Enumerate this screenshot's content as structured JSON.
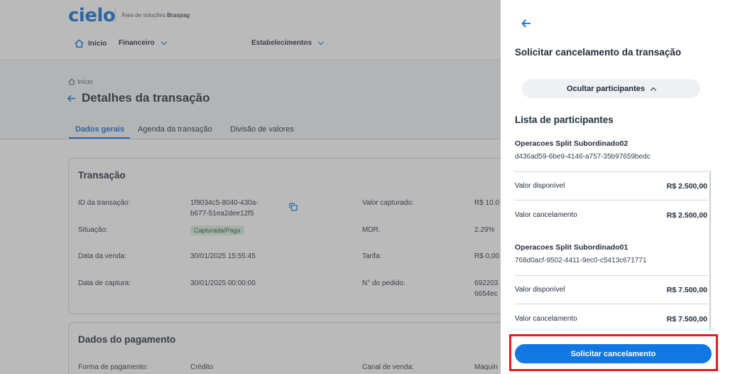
{
  "header": {
    "logo": "cielo",
    "subtitle_prefix": "Área de soluções",
    "subtitle_brand": "Braspag",
    "nav": [
      {
        "label": "Início",
        "icon": "home-icon"
      },
      {
        "label": "Financeiro",
        "icon": "chevron-down-icon"
      },
      {
        "label": "Estabelecimentos",
        "icon": "chevron-down-icon"
      }
    ]
  },
  "page": {
    "breadcrumb": "Início",
    "title": "Detalhes da transação",
    "tabs": [
      {
        "label": "Dados gerais",
        "active": true
      },
      {
        "label": "Agenda da transação",
        "active": false
      },
      {
        "label": "Divisão de valores",
        "active": false
      }
    ]
  },
  "transacao": {
    "title": "Transação",
    "id_label": "ID da transação:",
    "id_value_1": "1f9034c5-8040-430a-",
    "id_value_2": "b677-51ea2dee12f5",
    "situacao_label": "Situação:",
    "situacao_value": "Capturada/Paga",
    "data_venda_label": "Data da venda:",
    "data_venda_value": "30/01/2025 15:55:45",
    "data_captura_label": "Data de captura:",
    "data_captura_value": "30/01/2025 00:00:00",
    "valor_capturado_label": "Valor capturado:",
    "valor_capturado_value": "R$ 10.0",
    "mdr_label": "MDR:",
    "mdr_value": "2.29%",
    "tarifa_label": "Tarifa:",
    "tarifa_value": "R$ 0,00",
    "pedido_label": "N° do pedido:",
    "pedido_value_1": "692203",
    "pedido_value_2": "6654ec"
  },
  "pagamento": {
    "title": "Dados do pagamento",
    "forma_label": "Forma de pagamento:",
    "forma_value": "Crédito",
    "canal_label": "Canal de venda:",
    "canal_value": "Maquin"
  },
  "panel": {
    "title": "Solicitar cancelamento da transação",
    "toggle_label": "Ocultar participantes",
    "list_title": "Lista de participantes",
    "participants": [
      {
        "name": "Operacoes Split Subordinado02",
        "id": "d436ad59-6be9-4146-a757-35b97659bedc",
        "disponivel_label": "Valor disponível",
        "disponivel_value": "R$ 2.500,00",
        "cancelamento_label": "Valor cancelamento",
        "cancelamento_value": "R$ 2.500,00"
      },
      {
        "name": "Operacoes Split Subordinado01",
        "id": "768d0acf-9502-4411-9ec0-c5413c671771",
        "disponivel_label": "Valor disponível",
        "disponivel_value": "R$ 7.500,00",
        "cancelamento_label": "Valor cancelamento",
        "cancelamento_value": "R$ 7.500,00"
      }
    ],
    "submit_label": "Solicitar cancelamento"
  },
  "colors": {
    "accent": "#1177e3",
    "brand": "#0f6fd6",
    "highlight": "#e11d24",
    "badge_bg": "#d9efe0"
  }
}
